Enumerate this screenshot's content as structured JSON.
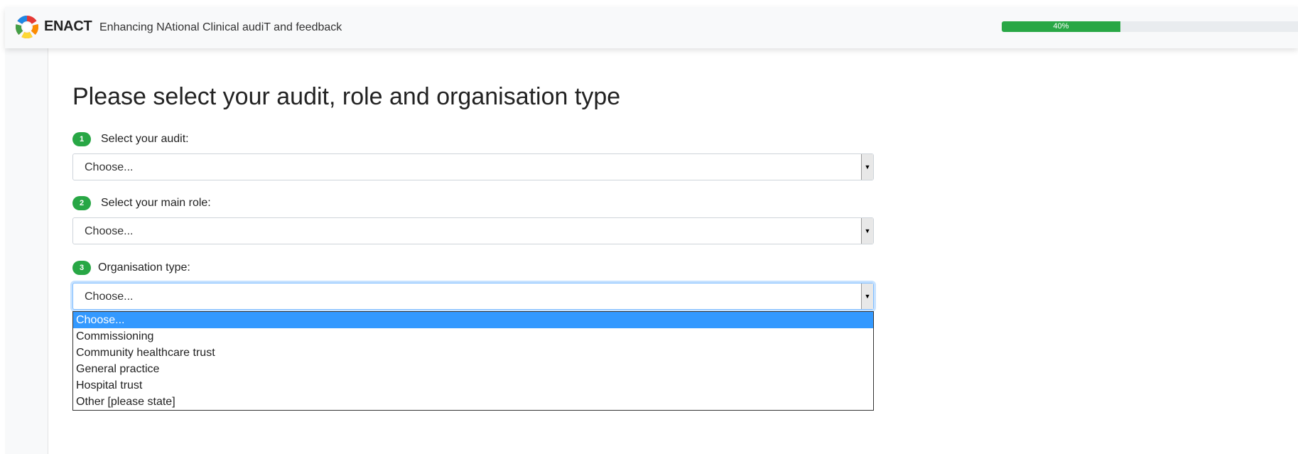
{
  "header": {
    "brand": "ENACT",
    "subtitle": "Enhancing NAtional Clinical audiT and feedback",
    "progress_percent": 40,
    "progress_label": "40%"
  },
  "page": {
    "title": "Please select your audit, role and organisation type"
  },
  "questions": [
    {
      "number": "1",
      "label": "Select your audit:",
      "value": "Choose..."
    },
    {
      "number": "2",
      "label": "Select your main role:",
      "value": "Choose..."
    },
    {
      "number": "3",
      "label": "Organisation type:",
      "value": "Choose..."
    }
  ],
  "org_dropdown": {
    "options": [
      "Choose...",
      "Commissioning",
      "Community healthcare trust",
      "General practice",
      "Hospital trust",
      "Other [please state]"
    ],
    "selected_index": 0
  },
  "colors": {
    "accent_green": "#28a745",
    "selected_option": "#3399ff",
    "logo": [
      "#e53935",
      "#fb8c00",
      "#fdd835",
      "#43a047",
      "#1e88e5",
      "#8e24aa"
    ]
  },
  "icons": {
    "logo": "enact-logo-ring",
    "select_arrow": "dropdown-arrow-icon"
  }
}
